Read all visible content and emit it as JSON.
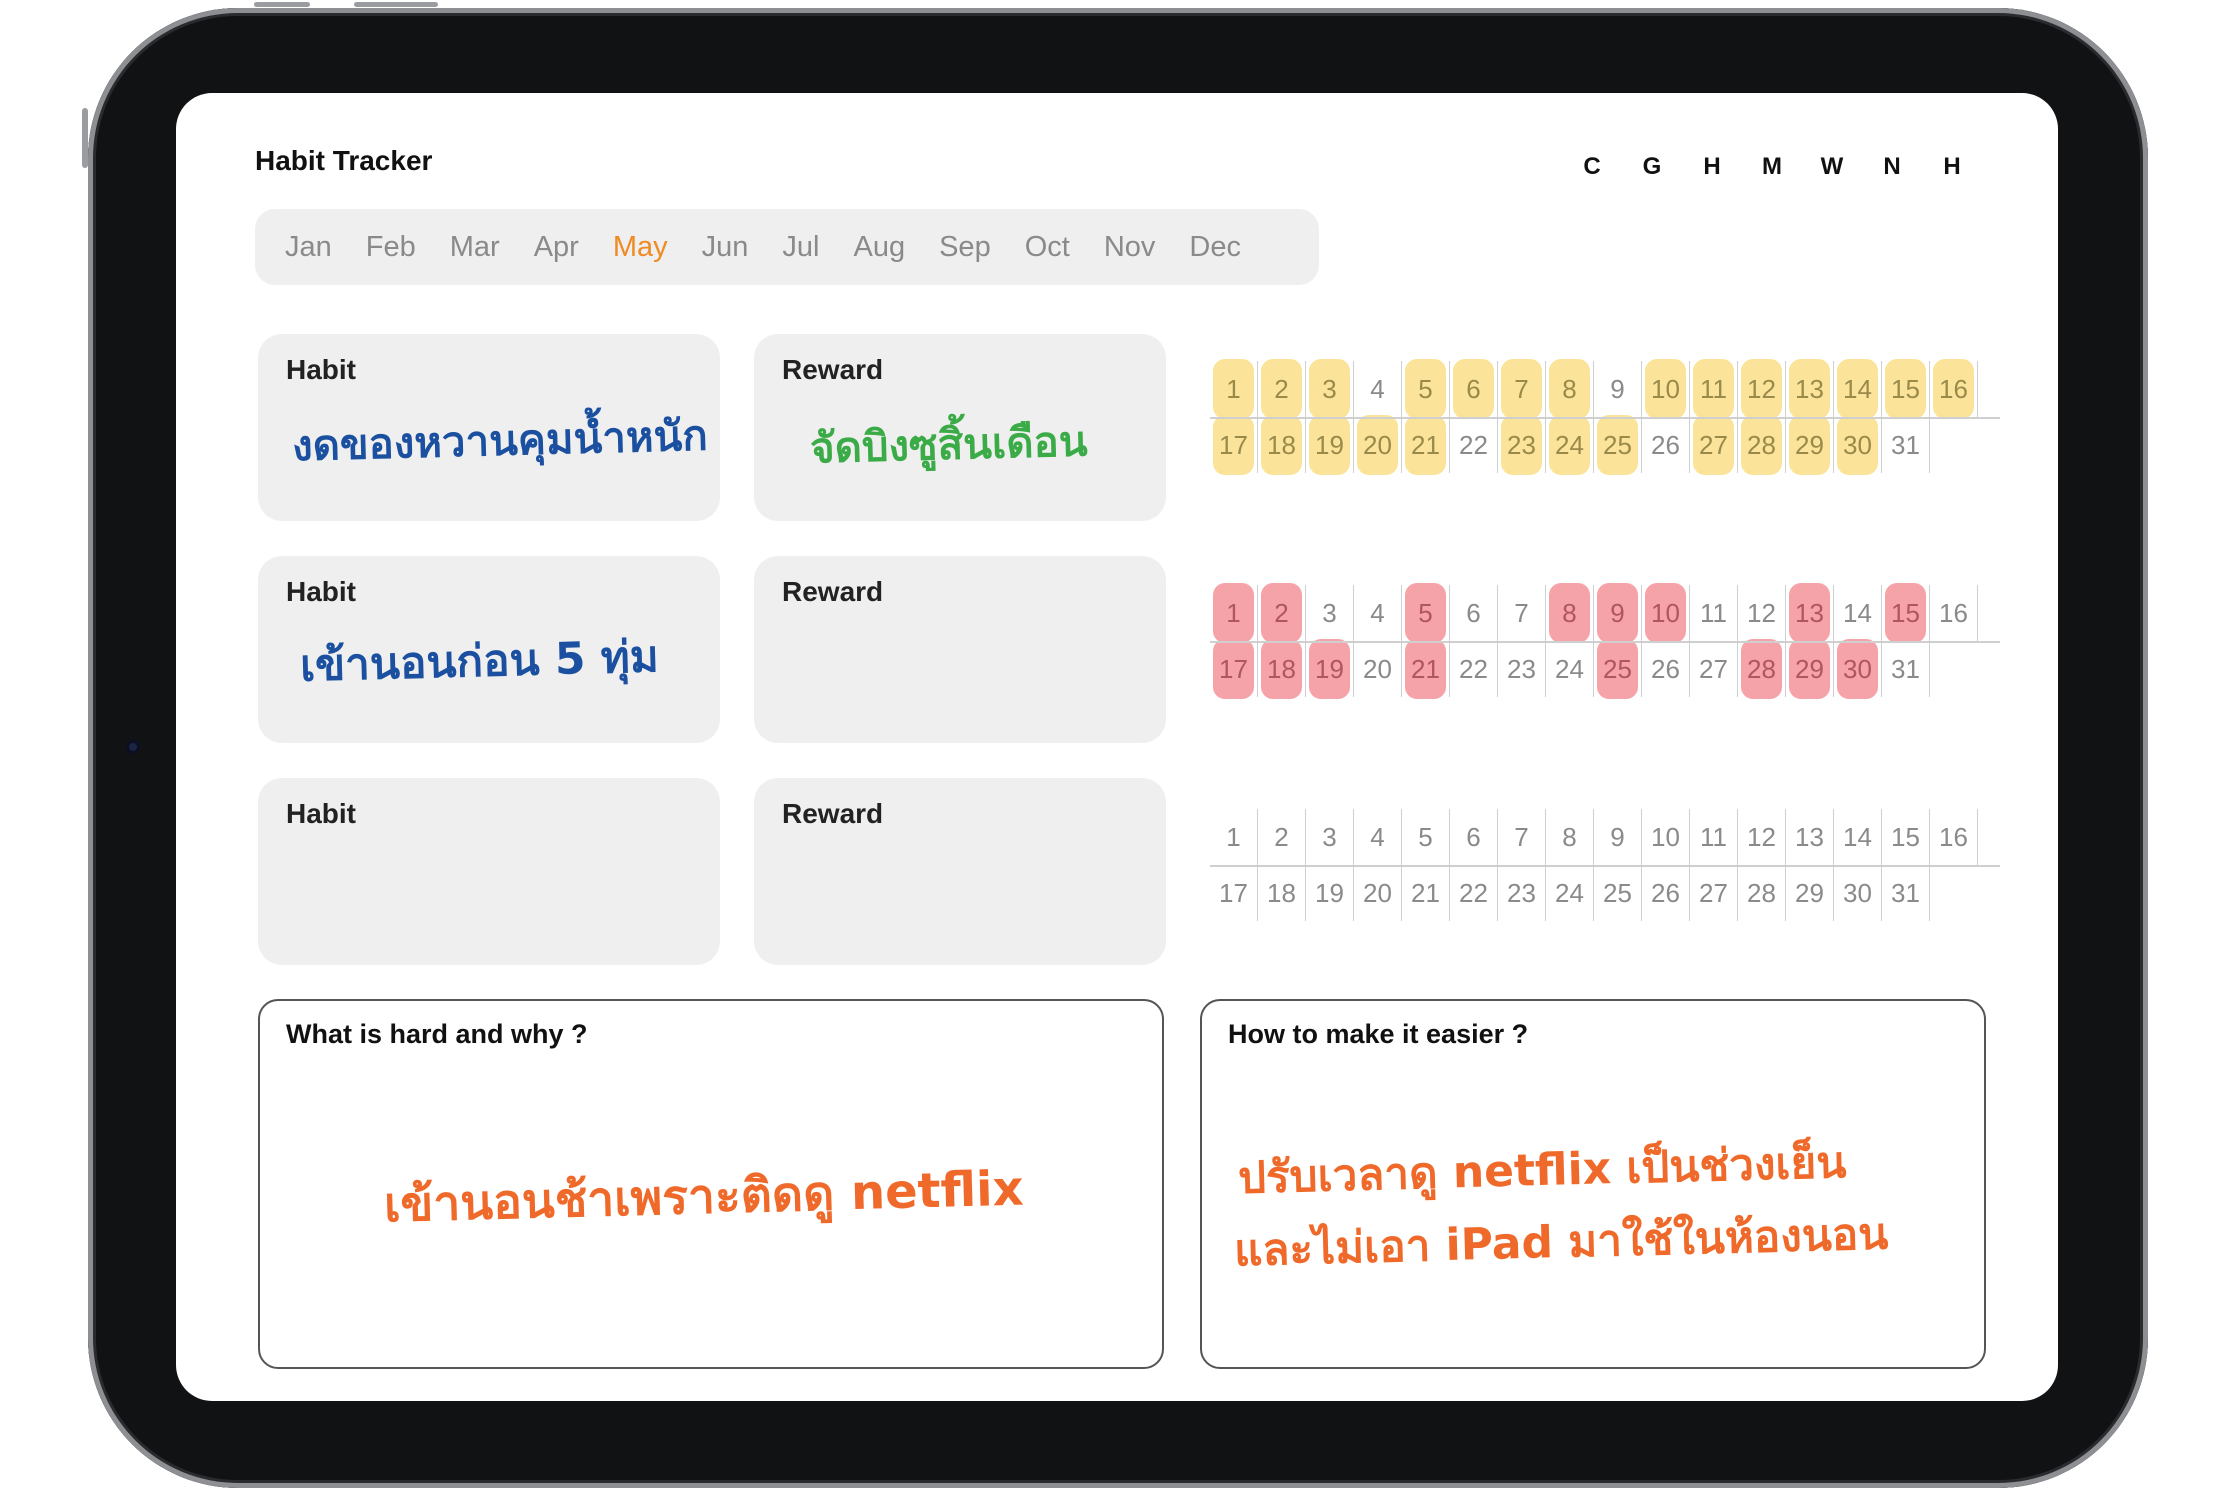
{
  "app": {
    "title": "Habit Tracker"
  },
  "letters": [
    "C",
    "G",
    "H",
    "M",
    "W",
    "N",
    "H"
  ],
  "months": {
    "items": [
      "Jan",
      "Feb",
      "Mar",
      "Apr",
      "May",
      "Jun",
      "Jul",
      "Aug",
      "Sep",
      "Oct",
      "Nov",
      "Dec"
    ],
    "selected": "May"
  },
  "rows": [
    {
      "habit_label": "Habit",
      "habit_text": "งดของหวานคุมน้ำหนัก",
      "reward_label": "Reward",
      "reward_text": "จัดบิงซูสิ้นเดือน",
      "checked_days": [
        1,
        2,
        3,
        5,
        6,
        7,
        8,
        10,
        11,
        12,
        13,
        14,
        15,
        16,
        17,
        18,
        19,
        20,
        21,
        23,
        24,
        25,
        27,
        28,
        29,
        30
      ],
      "highlight_color": "#fbe49a",
      "checked_text_color": "#9a8a4a"
    },
    {
      "habit_label": "Habit",
      "habit_text": "เข้านอนก่อน 5 ทุ่ม",
      "reward_label": "Reward",
      "reward_text": "",
      "checked_days": [
        1,
        2,
        5,
        8,
        9,
        10,
        13,
        15,
        17,
        18,
        19,
        21,
        25,
        28,
        29,
        30
      ],
      "highlight_color": "#f5a3a8",
      "checked_text_color": "#b0565c"
    },
    {
      "habit_label": "Habit",
      "habit_text": "",
      "reward_label": "Reward",
      "reward_text": "",
      "checked_days": [],
      "highlight_color": "#f5a3a8",
      "checked_text_color": "#8a8a8a"
    }
  ],
  "reflection": {
    "hard_label": "What is hard and why ?",
    "hard_text": "เข้านอนช้าเพราะติดดู netflix",
    "easier_label": "How to make it easier ?",
    "easier_line1": "ปรับเวลาดู netflix เป็นช่วงเย็น",
    "easier_line2": "และไม่เอา iPad มาใช้ในห้องนอน"
  },
  "colors": {
    "month_active": "#f08a24",
    "habit_ink": "#1b4fa0",
    "reward_ink": "#3bab47",
    "note_ink": "#ef6a2a"
  }
}
